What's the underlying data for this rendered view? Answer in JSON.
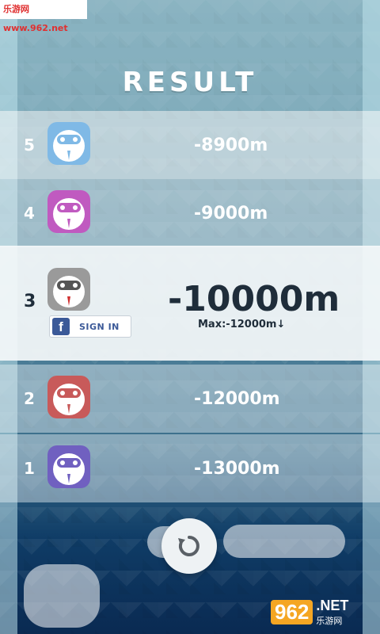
{
  "watermark": "乐游网 www.962.net",
  "title": "RESULT",
  "rows": [
    {
      "rank": "5",
      "score": "-8900m",
      "color": "#7fb9e6"
    },
    {
      "rank": "4",
      "score": "-9000m",
      "color": "#c05ac0"
    },
    {
      "rank": "2",
      "score": "-12000m",
      "color": "#c85a5a"
    },
    {
      "rank": "1",
      "score": "-13000m",
      "color": "#7060c0"
    }
  ],
  "current": {
    "rank": "3",
    "score": "-10000m",
    "max_label": "Max:-12000m↓",
    "color": "#9a9a9a"
  },
  "facebook": {
    "logo_letter": "f",
    "label": "SIGN IN"
  },
  "retry_icon": "retry-icon",
  "logo": {
    "num": "962",
    "net": ".NET",
    "sub": "乐游网"
  }
}
